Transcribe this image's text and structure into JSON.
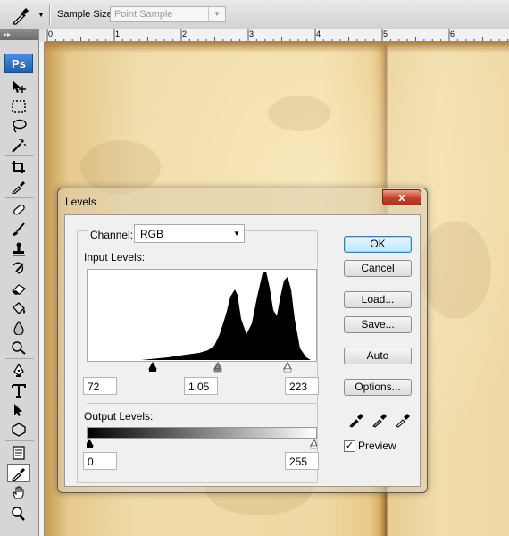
{
  "options_bar": {
    "tool_icon": "eyedropper-icon",
    "sample_size_label": "Sample Size:",
    "sample_size_value": "Point Sample"
  },
  "tools": {
    "logo": "Ps",
    "items": [
      "move-icon",
      "marquee-icon",
      "lasso-icon",
      "magic-wand-icon",
      "crop-icon",
      "eyedropper-icon",
      "healing-brush-icon",
      "brush-icon",
      "clone-stamp-icon",
      "history-brush-icon",
      "eraser-icon",
      "paint-bucket-icon",
      "blur-icon",
      "dodge-icon",
      "pen-icon",
      "type-icon",
      "path-selection-icon",
      "shape-icon",
      "notes-icon",
      "color-sampler-icon",
      "hand-icon",
      "zoom-icon"
    ],
    "active": "color-sampler-icon"
  },
  "ruler": {
    "labels": [
      "0",
      "1",
      "2",
      "3",
      "4",
      "5",
      "6"
    ]
  },
  "levels": {
    "title": "Levels",
    "close_glyph": "x",
    "channel_label": "Channel:",
    "channel_value": "RGB",
    "input_levels_label": "Input Levels:",
    "input_black": "72",
    "input_gamma": "1.05",
    "input_white": "223",
    "output_levels_label": "Output Levels:",
    "output_black": "0",
    "output_white": "255",
    "buttons": {
      "ok": "OK",
      "cancel": "Cancel",
      "load": "Load...",
      "save": "Save...",
      "auto": "Auto",
      "options": "Options..."
    },
    "preview_label": "Preview",
    "preview_checked": true
  }
}
